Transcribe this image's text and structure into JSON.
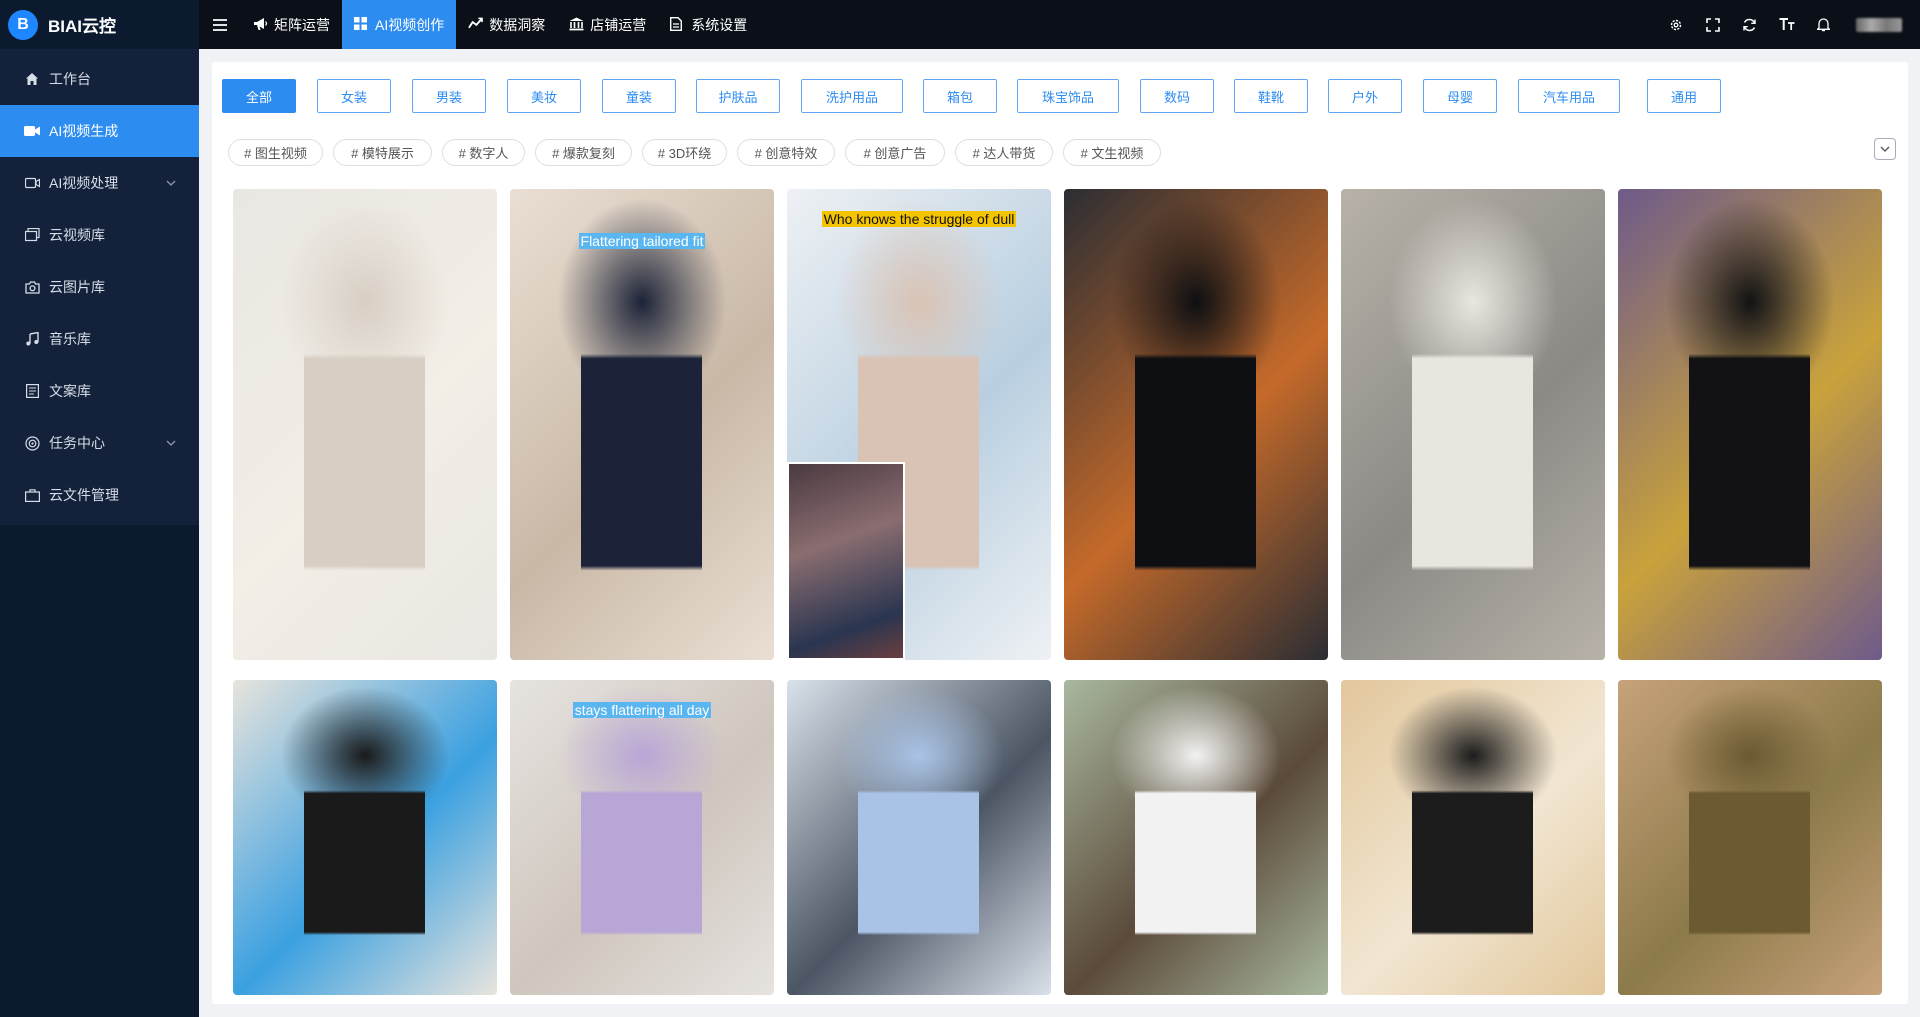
{
  "app": {
    "logo_letter": "B",
    "title": "BIAI云控"
  },
  "sidebar": {
    "items": [
      {
        "label": "工作台",
        "icon": "home-icon",
        "active": false,
        "expandable": false
      },
      {
        "label": "AI视频生成",
        "icon": "video-camera-icon",
        "active": true,
        "expandable": false
      },
      {
        "label": "AI视频处理",
        "icon": "video-process-icon",
        "active": false,
        "expandable": true
      },
      {
        "label": "云视频库",
        "icon": "video-library-icon",
        "active": false,
        "expandable": false
      },
      {
        "label": "云图片库",
        "icon": "camera-icon",
        "active": false,
        "expandable": false
      },
      {
        "label": "音乐库",
        "icon": "music-note-icon",
        "active": false,
        "expandable": false
      },
      {
        "label": "文案库",
        "icon": "document-icon",
        "active": false,
        "expandable": false
      },
      {
        "label": "任务中心",
        "icon": "target-icon",
        "active": false,
        "expandable": true
      },
      {
        "label": "云文件管理",
        "icon": "briefcase-icon",
        "active": false,
        "expandable": false
      }
    ]
  },
  "topnav": {
    "tabs": [
      {
        "label": "矩阵运营",
        "icon": "megaphone-icon",
        "active": false
      },
      {
        "label": "AI视频创作",
        "icon": "grid-icon",
        "active": true
      },
      {
        "label": "数据洞察",
        "icon": "chart-icon",
        "active": false
      },
      {
        "label": "店铺运营",
        "icon": "bank-icon",
        "active": false
      },
      {
        "label": "系统设置",
        "icon": "file-icon",
        "active": false
      }
    ],
    "right_icons": [
      "settings-icon",
      "fullscreen-icon",
      "refresh-icon",
      "font-size-icon",
      "bell-icon"
    ]
  },
  "categories": {
    "selected": "全部",
    "items": [
      "全部",
      "女装",
      "男装",
      "美妆",
      "童装",
      "护肤品",
      "洗护用品",
      "箱包",
      "珠宝饰品",
      "数码",
      "鞋靴",
      "户外",
      "母婴",
      "汽车用品",
      "通用"
    ]
  },
  "tags": [
    "# 图生视频",
    "# 模特展示",
    "# 数字人",
    "# 爆款复刻",
    "# 3D环绕",
    "# 创意特效",
    "# 创意广告",
    "# 达人带货",
    "# 文生视频"
  ],
  "gallery": {
    "cards": [
      {
        "caption": "",
        "subject": "skincare product demo",
        "colors": [
          "#e9e7e2",
          "#d8cfc4",
          "#f3eee6"
        ]
      },
      {
        "caption": "Flattering tailored fit",
        "subject": "navy slip dress",
        "colors": [
          "#eadfd4",
          "#1c2338",
          "#c9b8a6"
        ]
      },
      {
        "caption": "Who knows the struggle of dull",
        "subject": "skincare spray ad",
        "colors": [
          "#eef1f4",
          "#d9c3b5",
          "#b9cfe0"
        ]
      },
      {
        "caption": "",
        "subject": "black racing t-shirt",
        "colors": [
          "#2b2d33",
          "#0e0f12",
          "#c56a2a"
        ]
      },
      {
        "caption": "",
        "subject": "white dress with handbag",
        "colors": [
          "#b8b2a8",
          "#e9e6e0",
          "#8b8a86"
        ]
      },
      {
        "caption": "",
        "subject": "streetwear sweatsuit",
        "colors": [
          "#6e5a8a",
          "#121214",
          "#c9a23b"
        ]
      },
      {
        "caption": "",
        "subject": "kids graphic tee",
        "colors": [
          "#e8e4dd",
          "#1a1a1a",
          "#3aa0e0"
        ]
      },
      {
        "caption": "stays flattering all day",
        "subject": "lilac slip dress",
        "colors": [
          "#e6e3e0",
          "#b8a6d6",
          "#cfc6bd"
        ]
      },
      {
        "caption": "",
        "subject": "backpack",
        "colors": [
          "#d9e1ea",
          "#a9c3e6",
          "#4b5563"
        ]
      },
      {
        "caption": "",
        "subject": "white crop top outfit",
        "colors": [
          "#a9b8a0",
          "#f2f2f2",
          "#5b4a3a"
        ]
      },
      {
        "caption": "",
        "subject": "leather jacket",
        "colors": [
          "#e2c79c",
          "#1c1c1c",
          "#f2e6d2"
        ]
      },
      {
        "caption": "",
        "subject": "olive skirt",
        "colors": [
          "#c7a27a",
          "#6b5a32",
          "#8c7a4a"
        ]
      }
    ]
  }
}
